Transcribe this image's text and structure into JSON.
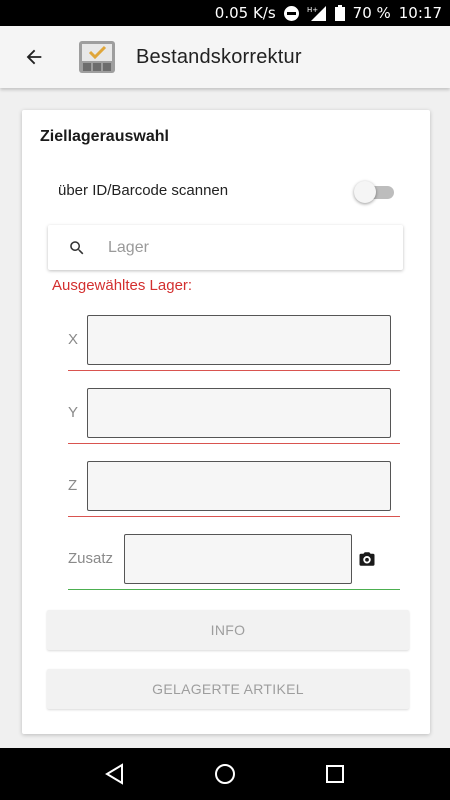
{
  "status_bar": {
    "speed": "0.05 K/s",
    "battery": "70 %",
    "time": "10:17",
    "icons": [
      "do-not-disturb-icon",
      "signal-icon",
      "battery-icon"
    ]
  },
  "app_bar": {
    "title": "Bestandskorrektur",
    "back_icon": "arrow-back-icon",
    "logo_icon": "inventory-check-icon"
  },
  "card": {
    "title": "Ziellagerauswahl",
    "scan_toggle": {
      "label": "über ID/Barcode scannen",
      "on": false
    },
    "search": {
      "placeholder": "Lager",
      "value": ""
    },
    "selected_label": "Ausgewähltes Lager:",
    "fields": [
      {
        "label": "X",
        "value": "",
        "status": "error"
      },
      {
        "label": "Y",
        "value": "",
        "status": "error"
      },
      {
        "label": "Z",
        "value": "",
        "status": "error"
      },
      {
        "label": "Zusatz",
        "value": "",
        "status": "ok"
      }
    ],
    "buttons": {
      "info": "INFO",
      "stored_items": "GELAGERTE ARTIKEL"
    }
  },
  "colors": {
    "error": "#d9534f",
    "error_text": "#d32f2f",
    "ok": "#4caf50",
    "accent": "#e0a63a"
  },
  "nav_bar": {
    "items": [
      "back-triangle-icon",
      "home-circle-icon",
      "recents-square-icon"
    ]
  }
}
